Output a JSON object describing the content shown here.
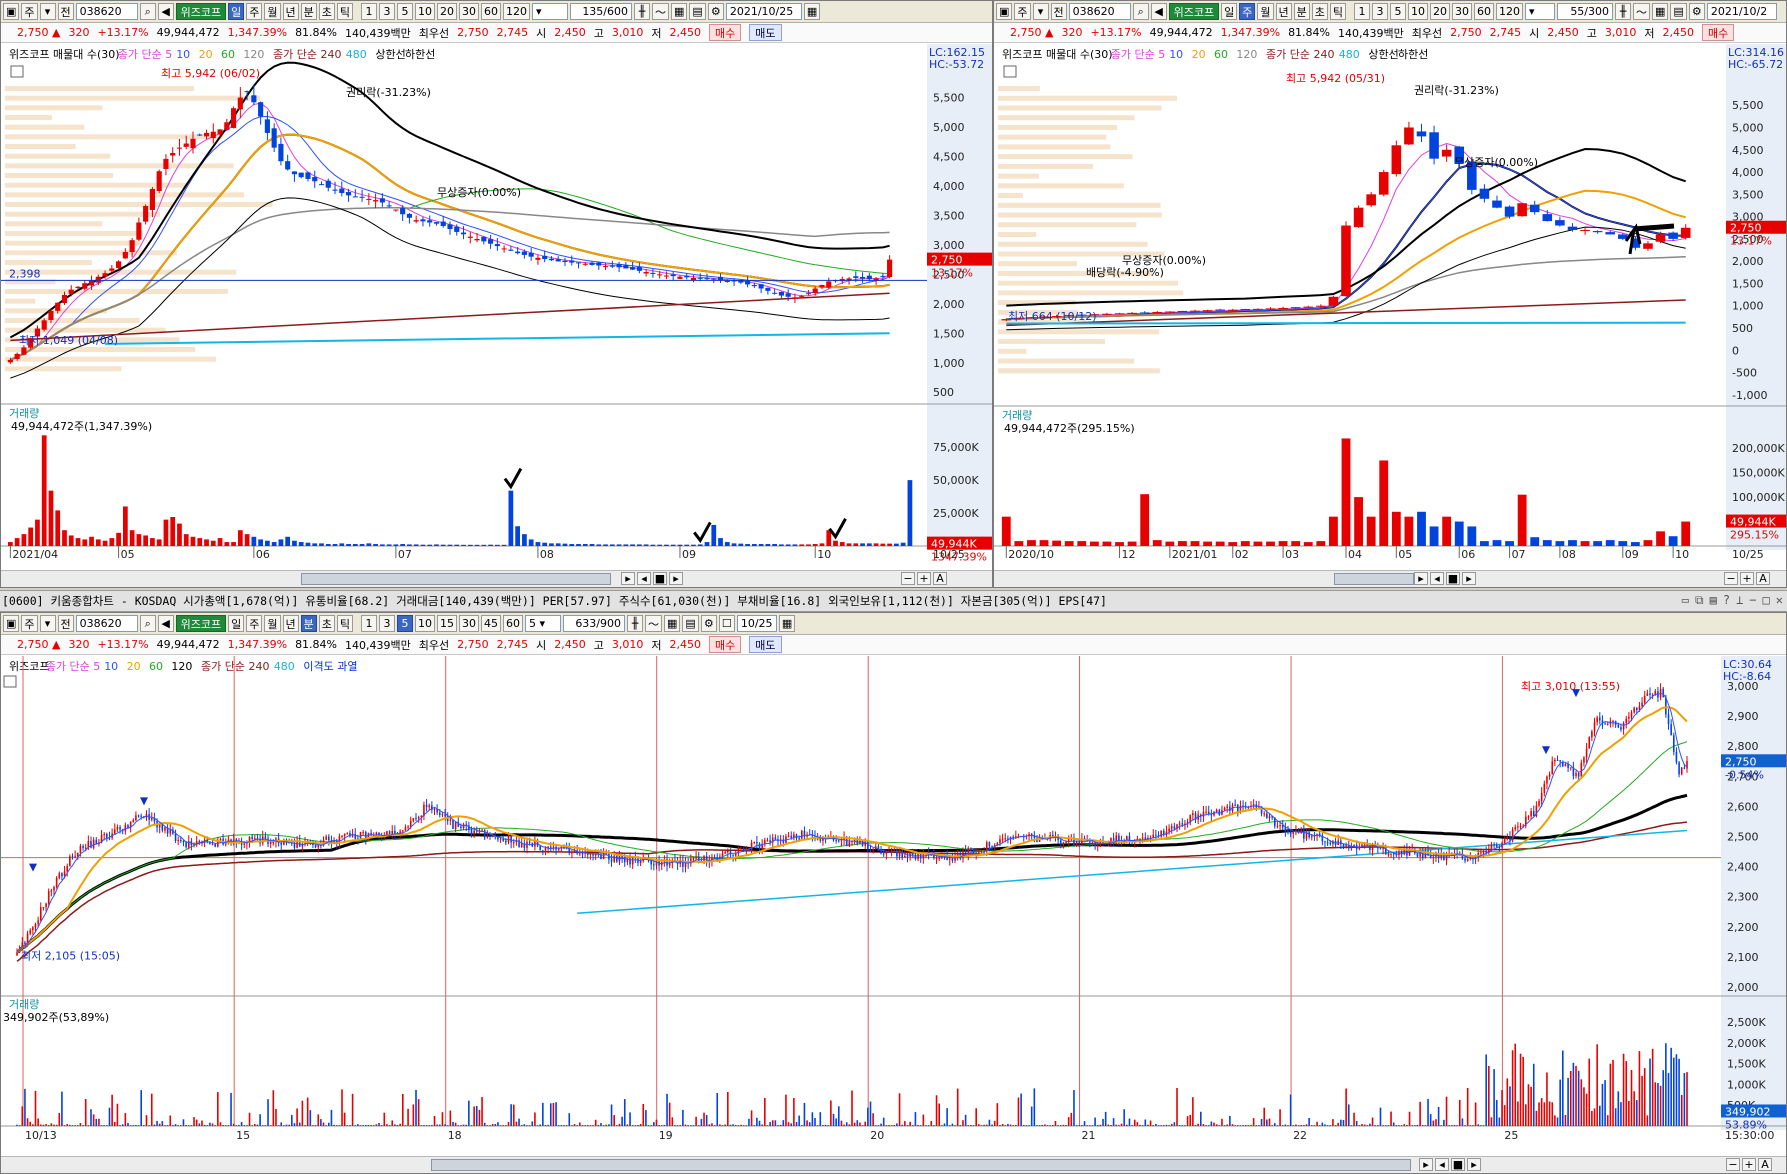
{
  "colors": {
    "up": "#e60000",
    "down": "#0044dd",
    "ma5": "#e040e0",
    "ma10": "#3050ff",
    "ma20": "#f0a000",
    "ma60": "#22aa22",
    "ma120": "#888888",
    "ma240": "#8b1a1a",
    "ma480": "#11b6e6",
    "band": "#000000",
    "supply": "#f5e3cc"
  },
  "daily": {
    "toolbar": {
      "items": [
        "주",
        "전"
      ],
      "code": "038620",
      "name": "위즈코프",
      "period_active": "일",
      "periods": [
        "주",
        "월",
        "년",
        "분",
        "초",
        "틱"
      ],
      "nums": [
        "1",
        "3",
        "5",
        "10",
        "20",
        "30",
        "60",
        "120"
      ],
      "count": "135/600",
      "date": "2021/10/25"
    },
    "quote": {
      "price": "2,750",
      "change": "320",
      "pct": "+13.17%",
      "volume": "49,944,472",
      "volpct": "1,347.39%",
      "ratio": "81.84%",
      "amount": "140,439백만",
      "pref_label": "최우선",
      "ask": "2,750",
      "bid": "2,745",
      "open_l": "시",
      "open": "2,450",
      "high_l": "고",
      "high": "3,010",
      "low_l": "저",
      "low": "2,450",
      "buy": "매수",
      "sell": "매도"
    },
    "legend": [
      {
        "text": "위즈코프 매물대 수(30)",
        "color": "#000000"
      },
      {
        "text": "종가 단순 5",
        "color": "#e040e0"
      },
      {
        "text": "10",
        "color": "#3050ff"
      },
      {
        "text": "20",
        "color": "#f0a000"
      },
      {
        "text": "60",
        "color": "#22aa22"
      },
      {
        "text": "120",
        "color": "#888888"
      },
      {
        "text": "종가 단순 240",
        "color": "#8b1a1a"
      },
      {
        "text": "480",
        "color": "#11b6e6"
      },
      {
        "text": "상한선",
        "color": "#000000"
      },
      {
        "text": "하한선",
        "color": "#000000"
      }
    ],
    "lc": "LC:162.15",
    "hc": "HC:-53.72",
    "price_axis": [
      "5,500",
      "5,000",
      "4,500",
      "4,000",
      "3,500",
      "3,000",
      "2,500",
      "2,000",
      "1,500",
      "1,000",
      "500"
    ],
    "price_ticks": [
      5500,
      5000,
      4500,
      4000,
      3500,
      3000,
      2500,
      2000,
      1500,
      1000,
      500
    ],
    "yrange": [
      300,
      5900
    ],
    "cur_label": "2,750",
    "cur_pct": "13.17%",
    "hline_label": "2,398",
    "hline": 2398,
    "annotations": [
      "최고 5,942 (06/02)",
      "권리락(-31.23%)",
      "무상증자(0.00%)",
      "최저 1,049 (04/08)"
    ],
    "vol_title": "거래량",
    "vol_value": "49,944,472주(1,347.39%)",
    "vol_axis": [
      "75,000K",
      "50,000K",
      "25,000K"
    ],
    "vol_ticks": [
      75000,
      50000,
      25000
    ],
    "vol_max": 85000,
    "vol_cur": "49,944K",
    "vol_cur_pct": "1347.39%",
    "x_labels": [
      "2021/04",
      "05",
      "06",
      "07",
      "08",
      "09",
      "10"
    ],
    "x_right": "10/25",
    "x_label_idx": [
      0,
      16,
      36,
      57,
      78,
      99,
      119
    ],
    "prices": [
      1049,
      1150,
      1260,
      1420,
      1580,
      1720,
      1880,
      2020,
      2150,
      2240,
      2290,
      2350,
      2400,
      2460,
      2520,
      2600,
      2720,
      2880,
      3080,
      3380,
      3660,
      3950,
      4250,
      4460,
      4560,
      4650,
      4720,
      4800,
      4860,
      4900,
      4920,
      4960,
      5080,
      5320,
      5500,
      5600,
      5420,
      5180,
      4900,
      4650,
      4420,
      4280,
      4200,
      4150,
      4120,
      4080,
      4020,
      3970,
      3920,
      3880,
      3840,
      3820,
      3800,
      3780,
      3760,
      3720,
      3660,
      3600,
      3520,
      3460,
      3420,
      3400,
      3380,
      3360,
      3320,
      3270,
      3220,
      3180,
      3140,
      3100,
      3060,
      3020,
      2980,
      2940,
      2900,
      2860,
      2830,
      2800,
      2780,
      2760,
      2740,
      2720,
      2710,
      2700,
      2690,
      2680,
      2660,
      2650,
      2640,
      2630,
      2620,
      2600,
      2580,
      2560,
      2540,
      2520,
      2500,
      2480,
      2470,
      2460,
      2450,
      2440,
      2430,
      2420,
      2410,
      2400,
      2390,
      2380,
      2360,
      2330,
      2300,
      2260,
      2220,
      2180,
      2140,
      2120,
      2110,
      2130,
      2180,
      2260,
      2320,
      2380,
      2400,
      2420,
      2430,
      2440,
      2430,
      2420,
      2430,
      2460,
      2750
    ],
    "volumes": [
      3000,
      6000,
      9000,
      14000,
      20000,
      84000,
      42000,
      27000,
      12000,
      8000,
      6000,
      5000,
      7000,
      5000,
      4000,
      6000,
      10000,
      30000,
      12000,
      9000,
      8000,
      6000,
      5000,
      20000,
      22000,
      17000,
      9000,
      7000,
      6000,
      5000,
      4000,
      6000,
      3000,
      3000,
      12000,
      9000,
      7000,
      5000,
      4000,
      3000,
      5000,
      7000,
      4000,
      3000,
      2500,
      2000,
      2000,
      1500,
      1500,
      2000,
      1500,
      1500,
      1500,
      2000,
      1500,
      1200,
      1200,
      1200,
      1500,
      1200,
      1200,
      1000,
      1000,
      1200,
      1000,
      1000,
      1000,
      900,
      900,
      900,
      900,
      1000,
      900,
      900,
      42000,
      15000,
      9000,
      5000,
      3000,
      2500,
      2000,
      2000,
      1800,
      1500,
      1500,
      1500,
      1500,
      1200,
      1200,
      1200,
      1200,
      1200,
      1200,
      1200,
      1200,
      1000,
      1000,
      1000,
      1000,
      1000,
      1000,
      1000,
      1200,
      3000,
      16000,
      6000,
      3000,
      2000,
      1800,
      1500,
      1500,
      1500,
      1500,
      1500,
      1200,
      1200,
      1200,
      1200,
      1200,
      1500,
      2000,
      12000,
      4000,
      3000,
      2000,
      2000,
      2000,
      2000,
      2000,
      1800,
      1800,
      1800,
      2500,
      50000
    ],
    "checks": [
      74,
      102,
      122,
      134
    ]
  },
  "weekly": {
    "toolbar": {
      "items": [
        "주",
        "전"
      ],
      "code": "038620",
      "name": "위즈코프",
      "period_active": "주",
      "periods": [
        "일",
        "월",
        "년",
        "분",
        "초",
        "틱"
      ],
      "nums": [
        "1",
        "3",
        "5",
        "10",
        "20",
        "30",
        "60",
        "120"
      ],
      "count": "55/300",
      "date": "2021/10/2"
    },
    "quote": {
      "price": "2,750",
      "change": "320",
      "pct": "+13.17%",
      "volume": "49,944,472",
      "volpct": "1,347.39%",
      "ratio": "81.84%",
      "amount": "140,439백만",
      "pref_label": "최우선",
      "ask": "2,750",
      "bid": "2,745",
      "open_l": "시",
      "open": "2,450",
      "high_l": "고",
      "high": "3,010",
      "low_l": "저",
      "low": "2,450",
      "buy": "매수"
    },
    "legend": [
      {
        "text": "위즈코프 매물대 수(30)",
        "color": "#000000"
      },
      {
        "text": "종가 단순 5",
        "color": "#e040e0"
      },
      {
        "text": "10",
        "color": "#3050ff"
      },
      {
        "text": "20",
        "color": "#f0a000"
      },
      {
        "text": "60",
        "color": "#22aa22"
      },
      {
        "text": "120",
        "color": "#888888"
      },
      {
        "text": "종가 단순 240",
        "color": "#8b1a1a"
      },
      {
        "text": "480",
        "color": "#11b6e6"
      },
      {
        "text": "상한선",
        "color": "#000000"
      },
      {
        "text": "하한선",
        "color": "#000000"
      }
    ],
    "lc": "LC:314.16",
    "hc": "HC:-65.72",
    "price_axis": [
      "5,500",
      "5,000",
      "4,500",
      "4,000",
      "3,500",
      "3,000",
      "2,500",
      "2,000",
      "1,500",
      "1,000",
      "500",
      "0",
      "-500",
      "-1,000"
    ],
    "price_ticks": [
      5500,
      5000,
      4500,
      4000,
      3500,
      3000,
      2500,
      2000,
      1500,
      1000,
      500,
      0,
      -500,
      -1000
    ],
    "yrange": [
      -1250,
      6200
    ],
    "cur_label": "2,750",
    "cur_pct": "13.17%",
    "annotations": [
      "최고 5,942 (05/31)",
      "권리락(-31.23%)",
      "무상증자(0.00%)",
      "배당락(-4.90%)",
      "무상증자(0.00%)",
      "최저 664 (10/12)"
    ],
    "vol_title": "거래량",
    "vol_value": "49,944,472주(295.15%)",
    "vol_axis": [
      "200,000K",
      "150,000K",
      "100,000K",
      "50,000K"
    ],
    "vol_ticks": [
      200000,
      150000,
      100000,
      50000
    ],
    "vol_max": 225000,
    "vol_cur": "49,944K",
    "vol_cur_pct": "295.15%",
    "x_labels": [
      "2020/10",
      "12",
      "2021/01",
      "02",
      "03",
      "04",
      "05",
      "06",
      "07",
      "08",
      "09",
      "10"
    ],
    "x_right": "10/25",
    "x_label_idx": [
      0,
      9,
      13,
      18,
      22,
      27,
      31,
      36,
      40,
      44,
      49,
      53
    ],
    "prices": [
      700,
      720,
      740,
      760,
      770,
      790,
      800,
      810,
      820,
      830,
      840,
      850,
      860,
      870,
      880,
      890,
      900,
      900,
      910,
      920,
      930,
      940,
      950,
      960,
      980,
      1000,
      1200,
      2800,
      3200,
      3500,
      4000,
      4600,
      5000,
      4800,
      4300,
      4500,
      4200,
      3600,
      3400,
      3200,
      3000,
      3300,
      3100,
      2900,
      2800,
      2700,
      2700,
      2650,
      2600,
      2500,
      2300,
      2400,
      2600,
      2500,
      2750
    ],
    "volumes": [
      60000,
      10000,
      12000,
      12000,
      11000,
      10000,
      10000,
      9000,
      9000,
      8000,
      9000,
      106000,
      12000,
      9000,
      10000,
      10000,
      9000,
      9000,
      8000,
      10000,
      9000,
      9000,
      10000,
      10000,
      8000,
      10000,
      60000,
      220000,
      100000,
      60000,
      175000,
      70000,
      60000,
      70000,
      40000,
      60000,
      50000,
      40000,
      10000,
      12000,
      10000,
      105000,
      18000,
      12000,
      10000,
      12000,
      10000,
      10000,
      12000,
      10000,
      8000,
      12000,
      30000,
      20000,
      50000
    ]
  },
  "title": {
    "text": "[0600] 키움종합차트 - KOSDAQ 시가총액[1,678(억)] 유통비율[68.2] 거래대금[140,439(백만)] PER[57.97] 주식수[61,030(천)] 부채비율[16.8] 외국인보유[1,112(천)] 자본금[305(억)] EPS[47]"
  },
  "minute": {
    "toolbar": {
      "items": [
        "주",
        "전"
      ],
      "code": "038620",
      "name": "위즈코프",
      "periods": [
        "일",
        "주",
        "월",
        "년",
        "분",
        "초",
        "틱"
      ],
      "period_active": "분",
      "nums": [
        "1",
        "3",
        "5",
        "10",
        "15",
        "30",
        "45",
        "60"
      ],
      "num_active": "5",
      "sel": "5",
      "count": "633/900",
      "date": "10/25"
    },
    "quote": {
      "price": "2,750",
      "change": "320",
      "pct": "+13.17%",
      "volume": "49,944,472",
      "volpct": "1,347.39%",
      "ratio": "81.84%",
      "amount": "140,439백만",
      "pref_label": "최우선",
      "ask": "2,750",
      "bid": "2,745",
      "open_l": "시",
      "open": "2,450",
      "high_l": "고",
      "high": "3,010",
      "low_l": "저",
      "low": "2,450",
      "buy": "매수",
      "sell": "매도"
    },
    "legend": [
      {
        "text": "위즈코프",
        "color": "#000000"
      },
      {
        "text": "종가 단순 5",
        "color": "#e040e0"
      },
      {
        "text": "10",
        "color": "#3050ff"
      },
      {
        "text": "20",
        "color": "#f0a000"
      },
      {
        "text": "60",
        "color": "#22aa22"
      },
      {
        "text": "120",
        "color": "#000000"
      },
      {
        "text": "종가 단순 240",
        "color": "#8b1a1a"
      },
      {
        "text": "480",
        "color": "#11b6e6"
      },
      {
        "text": "이격도 과열",
        "color": "#0030d0"
      }
    ],
    "lc": "LC:30.64",
    "hc": "HC:-8.64",
    "price_axis": [
      "3,000",
      "2,900",
      "2,800",
      "2,700",
      "2,600",
      "2,500",
      "2,400",
      "2,300",
      "2,200",
      "2,100",
      "2,000"
    ],
    "price_ticks": [
      3000,
      2900,
      2800,
      2700,
      2600,
      2500,
      2400,
      2300,
      2200,
      2100,
      2000
    ],
    "yrange": [
      1970,
      3060
    ],
    "cur_label": "2,750",
    "cur_pct": "-0.54%",
    "hline": 2430,
    "annotations": [
      "최고 3,010 (13:55)",
      "최저 2,105 (15:05)"
    ],
    "vol_title": "거래량",
    "vol_value": "349,902주(53,89%)",
    "vol_axis": [
      "2,500K",
      "2,000K",
      "1,500K",
      "1,000K",
      "500K"
    ],
    "vol_ticks": [
      2500000,
      2000000,
      1500000,
      1000000,
      500000
    ],
    "vol_max": 2650000,
    "vol_cur": "349,902",
    "vol_cur_pct": "53.89%",
    "x_labels": [
      "10/13",
      "15",
      "18",
      "19",
      "20",
      "21",
      "22",
      "25"
    ],
    "x_right": "15:30:00",
    "day_bounds": [
      0,
      0.1257,
      0.2516,
      0.3772,
      0.5031,
      0.6289,
      0.7548,
      0.8806
    ],
    "keypoints": [
      [
        0,
        2105
      ],
      [
        0.008,
        2180
      ],
      [
        0.02,
        2320
      ],
      [
        0.035,
        2450
      ],
      [
        0.06,
        2520
      ],
      [
        0.075,
        2570
      ],
      [
        0.085,
        2540
      ],
      [
        0.1,
        2470
      ],
      [
        0.125,
        2480
      ],
      [
        0.15,
        2490
      ],
      [
        0.17,
        2470
      ],
      [
        0.2,
        2500
      ],
      [
        0.23,
        2510
      ],
      [
        0.245,
        2600
      ],
      [
        0.26,
        2540
      ],
      [
        0.3,
        2480
      ],
      [
        0.34,
        2440
      ],
      [
        0.37,
        2420
      ],
      [
        0.4,
        2410
      ],
      [
        0.43,
        2450
      ],
      [
        0.47,
        2510
      ],
      [
        0.5,
        2480
      ],
      [
        0.53,
        2440
      ],
      [
        0.56,
        2430
      ],
      [
        0.6,
        2500
      ],
      [
        0.64,
        2480
      ],
      [
        0.68,
        2500
      ],
      [
        0.71,
        2580
      ],
      [
        0.74,
        2600
      ],
      [
        0.76,
        2520
      ],
      [
        0.8,
        2470
      ],
      [
        0.84,
        2440
      ],
      [
        0.87,
        2430
      ],
      [
        0.89,
        2480
      ],
      [
        0.91,
        2590
      ],
      [
        0.92,
        2760
      ],
      [
        0.935,
        2700
      ],
      [
        0.945,
        2900
      ],
      [
        0.96,
        2860
      ],
      [
        0.975,
        2960
      ],
      [
        0.985,
        2980
      ],
      [
        0.995,
        2720
      ],
      [
        1.0,
        2750
      ]
    ]
  }
}
